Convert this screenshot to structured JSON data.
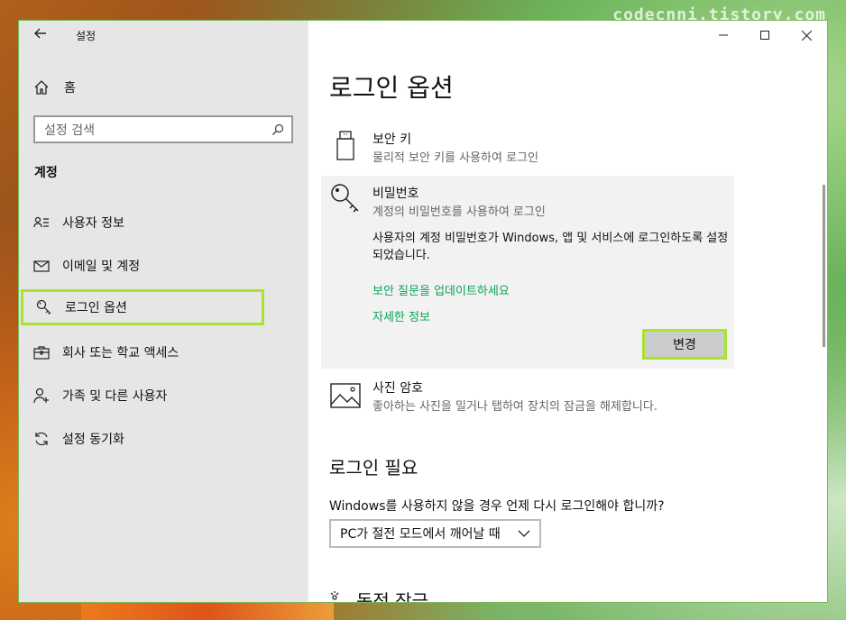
{
  "watermark": "codecnni.tistory.com",
  "window": {
    "title": "설정"
  },
  "sidebar": {
    "home_label": "홈",
    "search_placeholder": "설정 검색",
    "section_title": "계정",
    "items": [
      {
        "label": "사용자 정보",
        "icon": "person-card-icon"
      },
      {
        "label": "이메일 및 계정",
        "icon": "mail-icon"
      },
      {
        "label": "로그인 옵션",
        "icon": "key-icon",
        "selected": true
      },
      {
        "label": "회사 또는 학교 액세스",
        "icon": "briefcase-icon"
      },
      {
        "label": "가족 및 다른 사용자",
        "icon": "person-add-icon"
      },
      {
        "label": "설정 동기화",
        "icon": "sync-icon"
      }
    ]
  },
  "content": {
    "page_title": "로그인 옵션",
    "security_key": {
      "name": "보안 키",
      "desc": "물리적 보안 키를 사용하여 로그인"
    },
    "password": {
      "name": "비밀번호",
      "desc": "계정의 비밀번호를 사용하여 로그인",
      "body": "사용자의 계정 비밀번호가 Windows, 앱 및 서비스에 로그인하도록 설정되었습니다.",
      "link1": "보안 질문을 업데이트하세요",
      "link2": "자세한 정보",
      "button": "변경"
    },
    "picture_password": {
      "name": "사진 암호",
      "desc": "좋아하는 사진을 밀거나 탭하여 장치의 잠금을 해제합니다."
    },
    "require_signin": {
      "title": "로그인 필요",
      "question": "Windows를 사용하지 않을 경우 언제 다시 로그인해야 합니까?",
      "selected": "PC가 절전 모드에서 깨어날 때"
    },
    "dynamic_lock_title": "동적 잠금"
  },
  "colors": {
    "accent": "#0aa35a",
    "highlight": "#a7e32f",
    "sidebar_bg": "#e6e6e6"
  }
}
